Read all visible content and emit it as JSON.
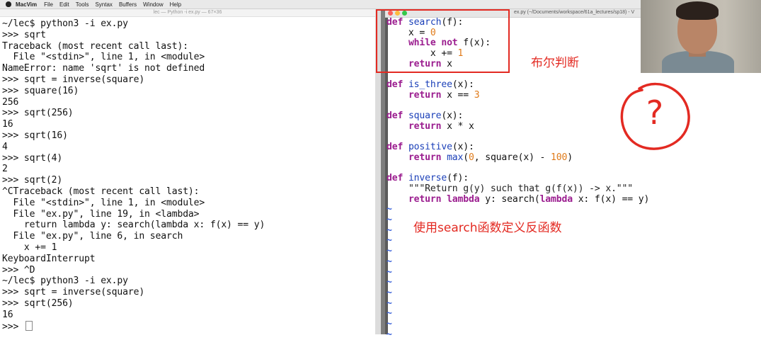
{
  "menubar": {
    "app": "MacVim",
    "items": [
      "File",
      "Edit",
      "Tools",
      "Syntax",
      "Buffers",
      "Window",
      "Help"
    ]
  },
  "terminal": {
    "title": "lec — Python -i ex.py — 67×36",
    "lines": [
      "~/lec$ python3 -i ex.py",
      ">>> sqrt",
      "Traceback (most recent call last):",
      "  File \"<stdin>\", line 1, in <module>",
      "NameError: name 'sqrt' is not defined",
      ">>> sqrt = inverse(square)",
      ">>> square(16)",
      "256",
      ">>> sqrt(256)",
      "16",
      ">>> sqrt(16)",
      "4",
      ">>> sqrt(4)",
      "2",
      ">>> sqrt(2)",
      "^CTraceback (most recent call last):",
      "  File \"<stdin>\", line 1, in <module>",
      "  File \"ex.py\", line 19, in <lambda>",
      "    return lambda y: search(lambda x: f(x) == y)",
      "  File \"ex.py\", line 6, in search",
      "    x += 1",
      "KeyboardInterrupt",
      ">>> ^D",
      "~/lec$ python3 -i ex.py",
      ">>> sqrt = inverse(square)",
      ">>> sqrt(256)",
      "16"
    ],
    "prompt": ">>> "
  },
  "editor": {
    "title": "ex.py (~/Documents/workspace/61a_lectures/sp18) - V",
    "lines": [
      [
        [
          "kw",
          "def"
        ],
        [
          "t",
          " "
        ],
        [
          "fn",
          "search"
        ],
        [
          "t",
          "(f):"
        ]
      ],
      [
        [
          "t",
          "    x = "
        ],
        [
          "num",
          "0"
        ]
      ],
      [
        [
          "t",
          "    "
        ],
        [
          "kw",
          "while"
        ],
        [
          "t",
          " "
        ],
        [
          "kw",
          "not"
        ],
        [
          "t",
          " f(x):"
        ]
      ],
      [
        [
          "t",
          "        x += "
        ],
        [
          "num",
          "1"
        ]
      ],
      [
        [
          "t",
          "    "
        ],
        [
          "kw",
          "return"
        ],
        [
          "t",
          " x"
        ]
      ],
      [
        [
          "t",
          ""
        ]
      ],
      [
        [
          "kw",
          "def"
        ],
        [
          "t",
          " "
        ],
        [
          "fn",
          "is_three"
        ],
        [
          "t",
          "(x):"
        ]
      ],
      [
        [
          "t",
          "    "
        ],
        [
          "kw",
          "return"
        ],
        [
          "t",
          " x == "
        ],
        [
          "num",
          "3"
        ]
      ],
      [
        [
          "t",
          ""
        ]
      ],
      [
        [
          "kw",
          "def"
        ],
        [
          "t",
          " "
        ],
        [
          "fn",
          "square"
        ],
        [
          "t",
          "(x):"
        ]
      ],
      [
        [
          "t",
          "    "
        ],
        [
          "kw",
          "return"
        ],
        [
          "t",
          " x * x"
        ]
      ],
      [
        [
          "t",
          ""
        ]
      ],
      [
        [
          "kw",
          "def"
        ],
        [
          "t",
          " "
        ],
        [
          "fn",
          "positive"
        ],
        [
          "t",
          "(x):"
        ]
      ],
      [
        [
          "t",
          "    "
        ],
        [
          "kw",
          "return"
        ],
        [
          "t",
          " "
        ],
        [
          "fn",
          "max"
        ],
        [
          "t",
          "("
        ],
        [
          "num",
          "0"
        ],
        [
          "t",
          ", square(x) - "
        ],
        [
          "num",
          "100"
        ],
        [
          "t",
          ")"
        ]
      ],
      [
        [
          "t",
          ""
        ]
      ],
      [
        [
          "kw",
          "def"
        ],
        [
          "t",
          " "
        ],
        [
          "fn",
          "inverse"
        ],
        [
          "t",
          "(f):"
        ]
      ],
      [
        [
          "t",
          "    "
        ],
        [
          "doc",
          "\"\"\"Return g(y) such that g(f(x)) -> x.\"\"\""
        ]
      ],
      [
        [
          "t",
          "    "
        ],
        [
          "kw",
          "return"
        ],
        [
          "t",
          " "
        ],
        [
          "kw",
          "lambda"
        ],
        [
          "t",
          " y: search("
        ],
        [
          "kw",
          "lambda"
        ],
        [
          "t",
          " x: f(x) == y)"
        ]
      ],
      [
        [
          "tilde",
          "~"
        ]
      ],
      [
        [
          "tilde",
          "~"
        ]
      ],
      [
        [
          "tilde",
          "~"
        ]
      ],
      [
        [
          "tilde",
          "~"
        ]
      ],
      [
        [
          "tilde",
          "~"
        ]
      ],
      [
        [
          "tilde",
          "~"
        ]
      ],
      [
        [
          "tilde",
          "~"
        ]
      ],
      [
        [
          "tilde",
          "~"
        ]
      ],
      [
        [
          "tilde",
          "~"
        ]
      ],
      [
        [
          "tilde",
          "~"
        ]
      ],
      [
        [
          "tilde",
          "~"
        ]
      ],
      [
        [
          "tilde",
          "~"
        ]
      ],
      [
        [
          "tilde",
          "~"
        ]
      ]
    ]
  },
  "annotations": {
    "boolean_note": "布尔判断",
    "inverse_note": "使用search函数定义反函数",
    "question_mark": "?"
  },
  "colors": {
    "annotation_red": "#e32a22",
    "keyword": "#9b1d8f",
    "function": "#1a3fb8",
    "number": "#e07b1a",
    "tilde": "#3b62d9"
  }
}
